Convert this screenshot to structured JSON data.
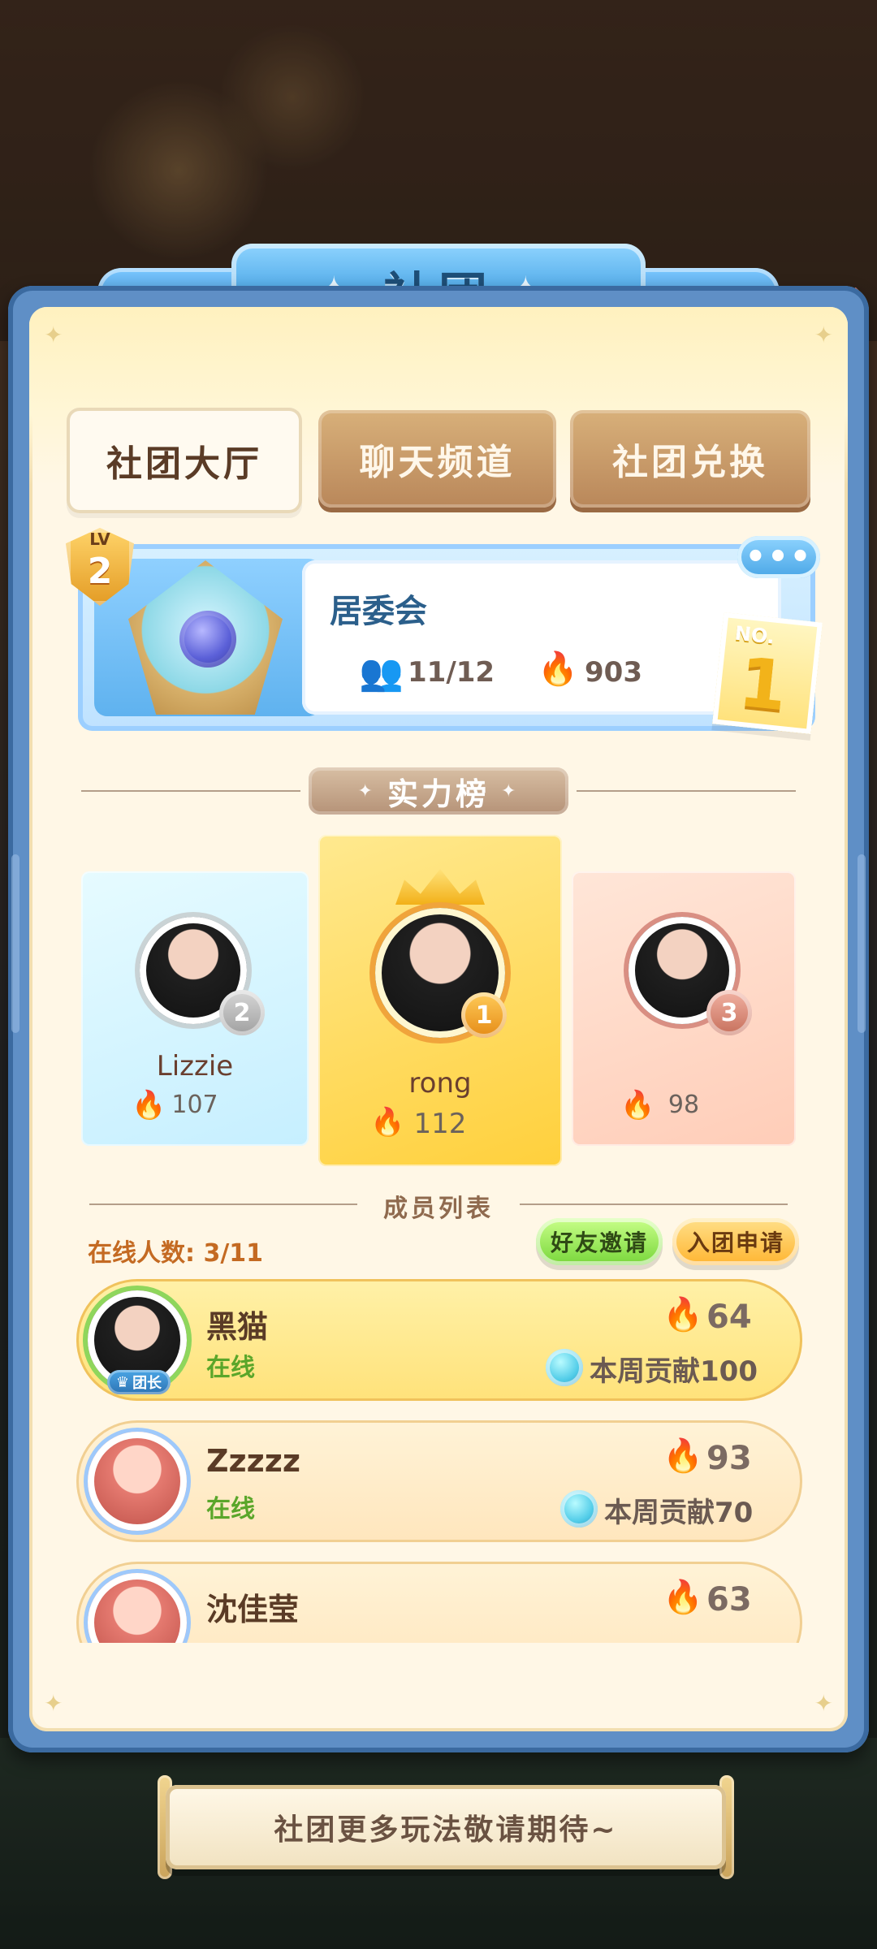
{
  "header": {
    "title": "社团"
  },
  "tabs": [
    {
      "label": "社团大厅",
      "active": true
    },
    {
      "label": "聊天频道",
      "active": false
    },
    {
      "label": "社团兑换",
      "active": false
    }
  ],
  "club": {
    "level_prefix": "LV",
    "level": "2",
    "name": "居委会",
    "members": "11/12",
    "power": "903",
    "rank_prefix": "NO.",
    "rank": "1",
    "more_label": "•••"
  },
  "leaderboard": {
    "title": "实力榜",
    "top3": [
      {
        "rank": "2",
        "name": "Lizzie",
        "power": "107"
      },
      {
        "rank": "1",
        "name": "rong",
        "power": "112"
      },
      {
        "rank": "3",
        "name": "",
        "power": "98"
      }
    ]
  },
  "members_section": {
    "title": "成员列表",
    "online_count": "在线人数: 3/11",
    "buttons": {
      "invite": "好友邀请",
      "apply": "入团申请"
    },
    "members": [
      {
        "name": "黑猫",
        "status": "在线",
        "power": "64",
        "contribution": "本周贡献100",
        "role_badge": "团长"
      },
      {
        "name": "Zzzzz",
        "status": "在线",
        "power": "93",
        "contribution": "本周贡献70"
      },
      {
        "name": "沈佳莹",
        "status": "",
        "power": "63",
        "contribution": ""
      }
    ]
  },
  "footer": {
    "banner_text": "社团更多玩法敬请期待~"
  },
  "colors": {
    "accent_blue": "#4aa6e6",
    "fire": "#ff6a2a",
    "online_green": "#5aa62a"
  },
  "icons": {
    "close": "close-icon",
    "members": "members-icon",
    "fire": "fire-icon",
    "contribution": "contribution-gem-icon",
    "crown": "crown-icon",
    "rose": "rose-emblem-icon"
  }
}
